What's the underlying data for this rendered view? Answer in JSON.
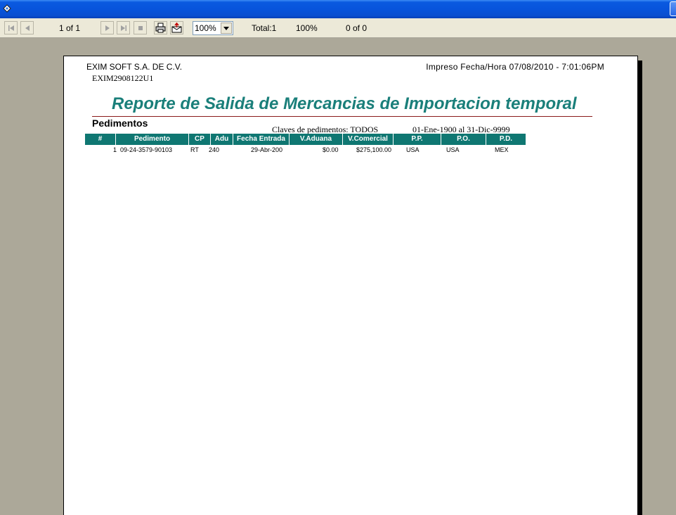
{
  "toolbar": {
    "page_indicator": "1 of 1",
    "zoom_value": "100%",
    "total_label": "Total:1",
    "percent_label": "100%",
    "found_label": "0 of 0",
    "icons": [
      "first-page-icon",
      "prev-page-icon",
      "next-page-icon",
      "last-page-icon",
      "stop-icon",
      "print-icon",
      "export-icon"
    ]
  },
  "report": {
    "company": "EXIM SOFT S.A. DE C.V.",
    "rfc": "EXIM2908122U1",
    "printed": "Impreso Fecha/Hora  07/08/2010 -  7:01:06PM",
    "title": "Reporte de Salida de Mercancias de Importacion temporal",
    "section": "Pedimentos",
    "claves": "Claves de pedimentos:  TODOS",
    "range": "01-Ene-1900 al 31-Dic-9999",
    "title_color": "#1a7f7a",
    "header_color": "#0f7772",
    "columns": [
      "#",
      "Pedimento",
      "CP",
      "Adu",
      "Fecha Entrada",
      "V.Aduana",
      "V.Comercial",
      "P.P.",
      "P.O.",
      "P.D."
    ],
    "rows": [
      {
        "num": "1",
        "pedimento": "09-24-3579-90103",
        "cp": "RT",
        "adu": "240",
        "fecha": "29-Abr-200",
        "vaduana": "$0.00",
        "vcomercial": "$275,100.00",
        "pp": "USA",
        "po": "USA",
        "pd": "MEX"
      }
    ]
  }
}
